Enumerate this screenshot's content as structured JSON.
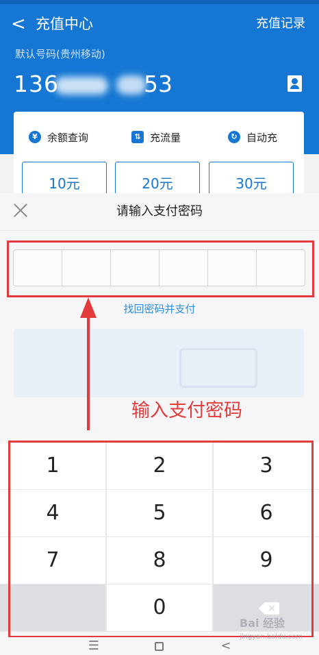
{
  "header": {
    "back_icon": "chevron-left-icon",
    "title": "充值中心",
    "records_label": "充值记录",
    "default_label": "默认号码(贵州移动)",
    "phone_prefix": "136",
    "phone_suffix": "53",
    "contact_icon": "contact-book-icon",
    "background_color": "#1577d3"
  },
  "quick_actions": [
    {
      "label": "余额查询",
      "icon": "yen-circle-icon",
      "glyph": "¥"
    },
    {
      "label": "充流量",
      "icon": "data-flow-icon",
      "glyph": "⇅"
    },
    {
      "label": "自动充",
      "icon": "auto-recharge-icon",
      "glyph": "↻"
    }
  ],
  "amounts": [
    "10元",
    "20元",
    "30元"
  ],
  "password_sheet": {
    "title": "请输入支付密码",
    "close_icon": "close-icon",
    "digit_count": 6,
    "forgot_link": "找回密码并支付"
  },
  "annotation": {
    "text": "输入支付密码",
    "color": "#e23b3b"
  },
  "keypad": {
    "keys": [
      "1",
      "2",
      "3",
      "4",
      "5",
      "6",
      "7",
      "8",
      "9",
      "",
      "0",
      "delete"
    ],
    "delete_icon": "backspace-icon"
  },
  "navbar": {
    "menu_icon": "menu-icon",
    "home_icon": "home-square-icon",
    "back_icon": "back-triangle-icon"
  },
  "watermark": {
    "brand": "Bai 经验",
    "sub": "jingyan.baidu.com"
  }
}
